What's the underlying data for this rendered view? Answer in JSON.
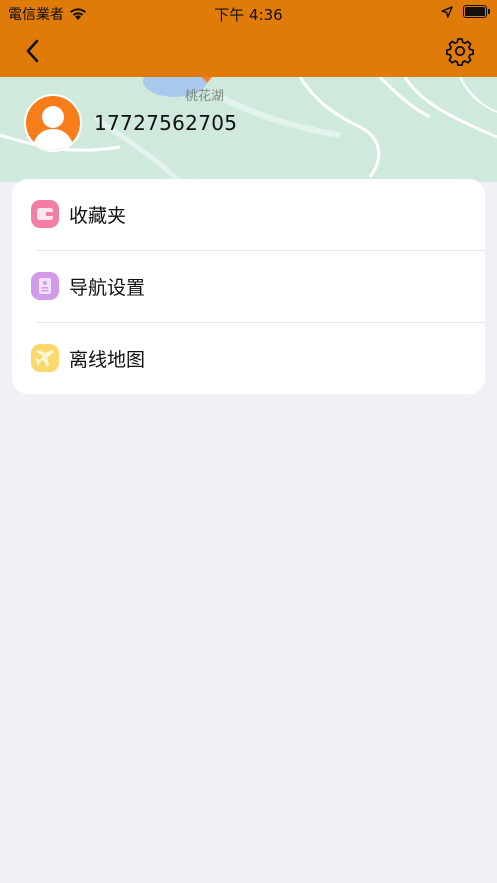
{
  "status_bar": {
    "carrier": "電信業者",
    "time": "下午 4:36"
  },
  "map": {
    "place_label": "桃花湖"
  },
  "profile": {
    "phone": "17727562705"
  },
  "menu": {
    "items": [
      {
        "label": "收藏夹",
        "icon": "wallet-icon",
        "color": "#f27fa3"
      },
      {
        "label": "导航设置",
        "icon": "document-icon",
        "color": "#d09be9"
      },
      {
        "label": "离线地图",
        "icon": "airplane-icon",
        "color": "#fbd86b"
      }
    ]
  },
  "colors": {
    "header": "#e07b0a",
    "background": "#f1f0f5",
    "avatar": "#f77d1b"
  }
}
